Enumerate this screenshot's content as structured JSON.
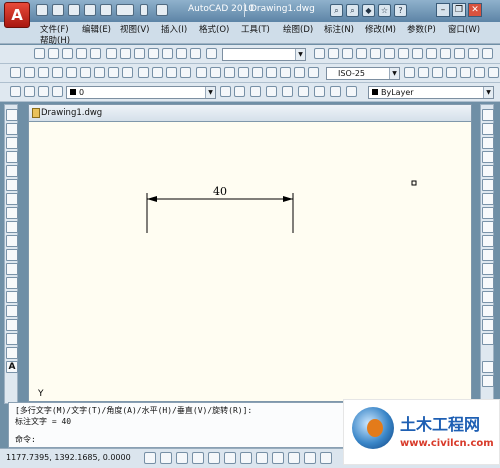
{
  "app": {
    "title": "AutoCAD 2010",
    "document": "Drawing1.dwg",
    "logo": "A"
  },
  "menubar": {
    "row1": [
      "文件(F)",
      "编辑(E)",
      "视图(V)",
      "插入(I)",
      "格式(O)",
      "工具(T)",
      "绘图(D)",
      "标注(N)",
      "修改(M)",
      "参数(P)",
      "窗口(W)"
    ],
    "row2": [
      "帮助(H)"
    ]
  },
  "toolbars": {
    "dimstyle": "ISO-25",
    "layer": "0",
    "linetype": "ByLayer"
  },
  "drawing": {
    "tab_label": "Drawing1.dwg",
    "dimension_text": "40",
    "ucs_label": "Y"
  },
  "command": {
    "line1": "[多行文字(M)/文字(T)/角度(A)/水平(H)/垂直(V)/旋转(R)]:",
    "line2": "标注文字 = 40",
    "prompt": "命令:"
  },
  "status": {
    "coords": "1177.7395, 1392.1685, 0.0000"
  },
  "watermark": {
    "title": "土木工程网",
    "url": "www.civilcn.com"
  },
  "colors": {
    "canvas": "#fffdf2",
    "title_bar": "#5d84a6",
    "logo_red": "#c22a1c",
    "watermark_blue": "#1e5fb3",
    "watermark_red": "#d83a2a"
  }
}
